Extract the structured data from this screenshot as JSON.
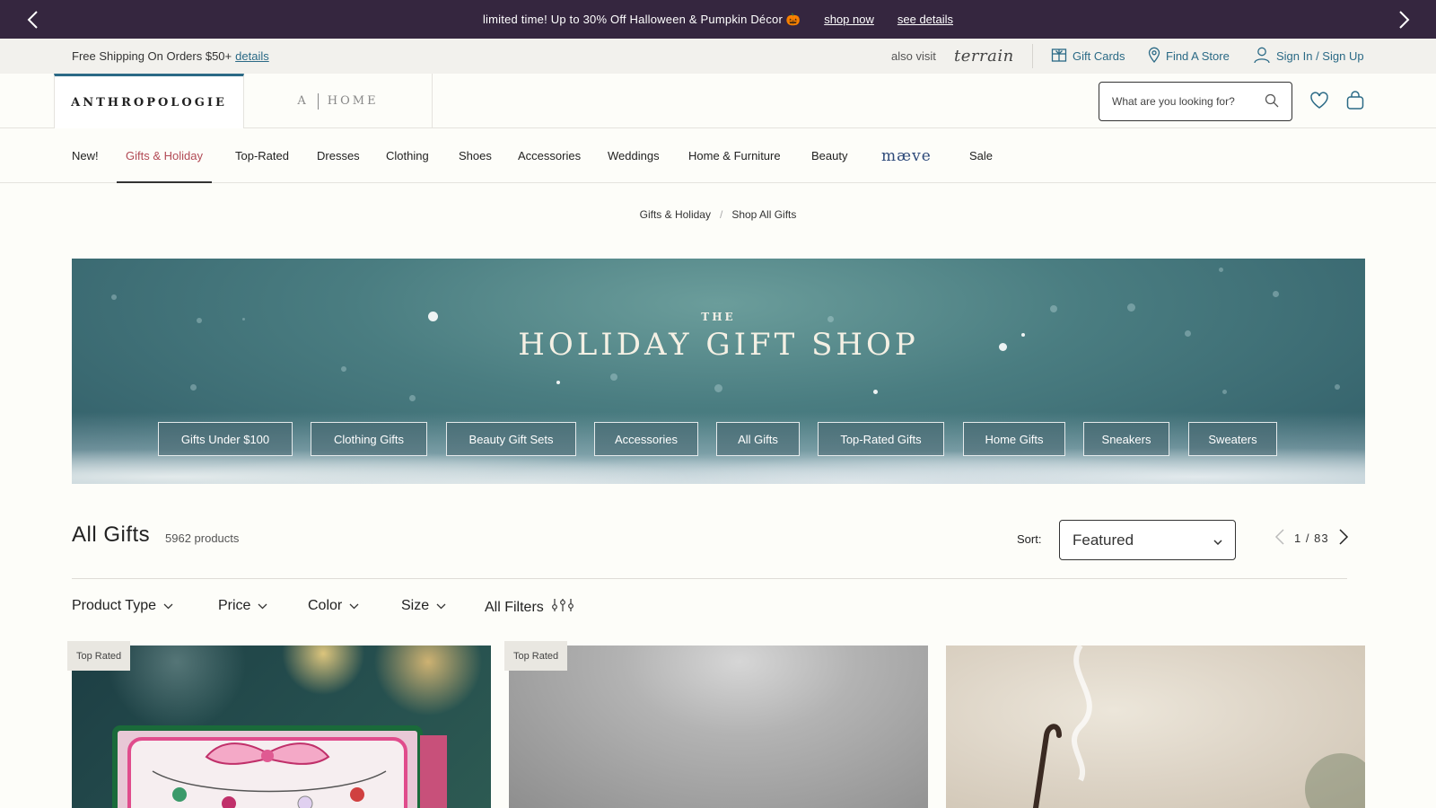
{
  "promo": {
    "message": "limited time! Up to 30% Off Halloween & Pumpkin Décor 🎃",
    "shop_now": "shop now",
    "see_details": "see details"
  },
  "utility": {
    "shipping": "Free Shipping On Orders $50+",
    "details_link": "details",
    "also_visit": "also visit",
    "terrain": "terrain",
    "gift_cards": "Gift Cards",
    "find_store": "Find A Store",
    "sign_in": "Sign In / Sign Up"
  },
  "header": {
    "brand": "ANTHROPOLOGIE",
    "home_a": "A",
    "home_word": "HOME",
    "search_placeholder": "What are you looking for?"
  },
  "nav": {
    "items": [
      "New!",
      "Gifts & Holiday",
      "Top-Rated",
      "Dresses",
      "Clothing",
      "Shoes",
      "Accessories",
      "Weddings",
      "Home & Furniture",
      "Beauty",
      "mæve",
      "Sale"
    ],
    "active_index": 1
  },
  "breadcrumb": {
    "parent": "Gifts & Holiday",
    "current": "Shop All Gifts",
    "separator": "/"
  },
  "hero": {
    "kicker": "THE",
    "title": "HOLIDAY GIFT SHOP",
    "chips": [
      "Gifts Under $100",
      "Clothing Gifts",
      "Beauty Gift Sets",
      "Accessories",
      "All Gifts",
      "Top-Rated Gifts",
      "Home Gifts",
      "Sneakers",
      "Sweaters"
    ]
  },
  "listing": {
    "title": "All Gifts",
    "count": "5962 products",
    "sort_label": "Sort:",
    "sort_value": "Featured",
    "page_current": "1",
    "page_sep": "/",
    "page_total": "83"
  },
  "filters": [
    "Product Type",
    "Price",
    "Color",
    "Size",
    "All Filters"
  ],
  "products": {
    "badges": [
      "Top Rated",
      "Top Rated"
    ]
  },
  "colors": {
    "promo_bg": "#35263f",
    "link": "#2b6a86",
    "active_nav": "#b24a55"
  }
}
